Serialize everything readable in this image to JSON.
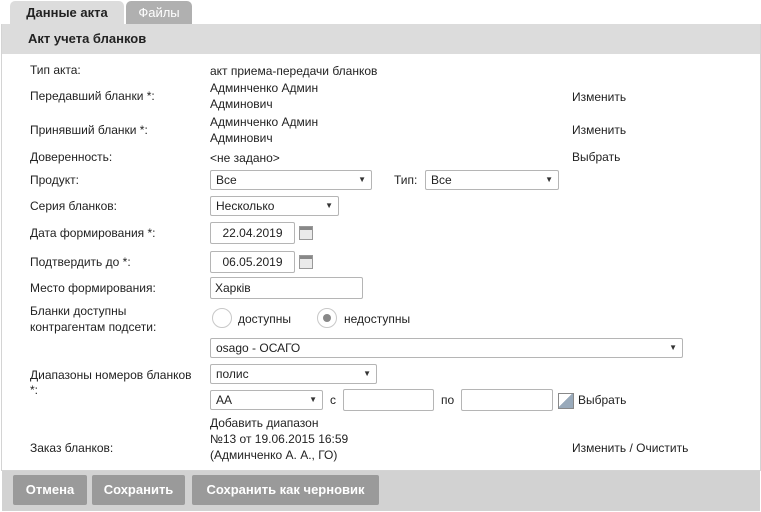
{
  "tabs": [
    {
      "label": "Данные акта"
    },
    {
      "label": "Файлы"
    }
  ],
  "panel": {
    "title": "Акт учета бланков"
  },
  "form": {
    "act_type": {
      "label": "Тип акта:",
      "value": "акт приема-передачи бланков"
    },
    "sender": {
      "label": "Передавший бланки *:",
      "value_line1": "Админченко Админ",
      "value_line2": "Админович",
      "action": "Изменить"
    },
    "receiver": {
      "label": "Принявший бланки *:",
      "value_line1": "Админченко Админ",
      "value_line2": "Админович",
      "action": "Изменить"
    },
    "proxy": {
      "label": "Доверенность:",
      "value": "<не задано>",
      "action": "Выбрать"
    },
    "product": {
      "label": "Продукт:",
      "value": "Все",
      "type_label": "Тип:",
      "type_value": "Все"
    },
    "series": {
      "label": "Серия бланков:",
      "value": "Несколько"
    },
    "date_formed": {
      "label": "Дата формирования *:",
      "value": "22.04.2019"
    },
    "confirm_until": {
      "label": "Подтвердить до *:",
      "value": "06.05.2019"
    },
    "place": {
      "label": "Место формирования:",
      "value": "Харків"
    },
    "availability": {
      "label_line1": "Бланки доступны",
      "label_line2": "контрагентам подсети:",
      "option1": "доступны",
      "option2": "недоступны",
      "selected": "недоступны"
    },
    "ranges": {
      "label_line1": "Диапазоны номеров бланков",
      "label_line2": "*:",
      "insurance": "osago - ОСАГО",
      "doc_type": "полис",
      "series": "АА",
      "from_label": "с",
      "from_value": "",
      "to_label": "по",
      "to_value": "",
      "pick_action": "Выбрать",
      "add_link": "Добавить диапазон"
    },
    "order": {
      "label": "Заказ бланков:",
      "value_line1": "№13 от 19.06.2015 16:59",
      "value_line2": "(Админченко А. А., ГО)",
      "action": "Изменить / Очистить"
    }
  },
  "buttons": {
    "cancel": "Отмена",
    "save": "Сохранить",
    "save_draft": "Сохранить как черновик"
  },
  "icons": {
    "calendar": "calendar-icon",
    "dropdown": "chevron-down-icon",
    "picker": "picker-icon"
  }
}
